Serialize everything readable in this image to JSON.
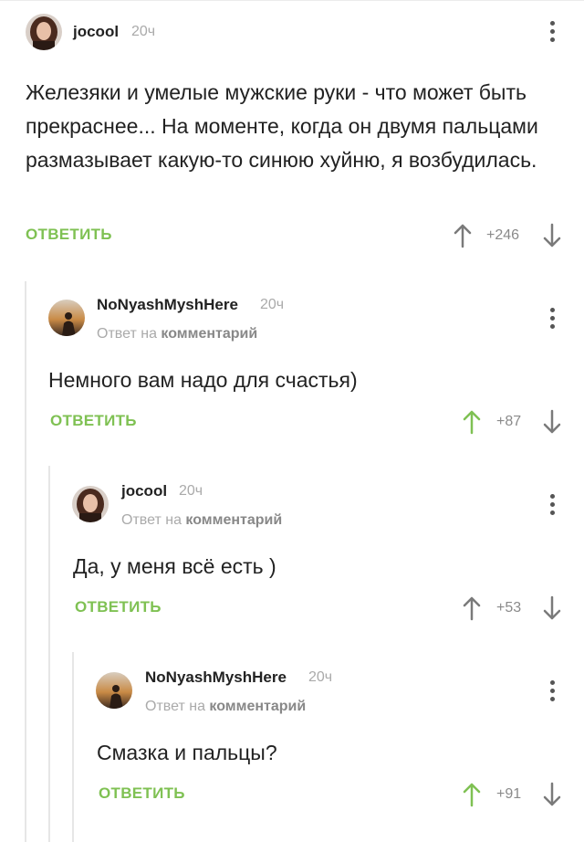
{
  "comments": [
    {
      "author": "jocool",
      "time": "20ч",
      "text": "Железяки и умелые мужские руки - что может быть прекраснее... На моменте, когда он двумя пальцами размазывает какую-то синюю хуйню, я возбудилась.",
      "reply_label": "ОТВЕТИТЬ",
      "score": "+246",
      "upvoted": false
    },
    {
      "author": "NoNyashMyshHere",
      "time": "20ч",
      "reply_prefix": "Ответ на",
      "reply_target": "комментарий",
      "text": "Немного вам надо для счастья)",
      "reply_label": "ОТВЕТИТЬ",
      "score": "+87",
      "upvoted": true
    },
    {
      "author": "jocool",
      "time": "20ч",
      "reply_prefix": "Ответ на",
      "reply_target": "комментарий",
      "text": "Да, у меня всё есть )",
      "reply_label": "ОТВЕТИТЬ",
      "score": "+53",
      "upvoted": false
    },
    {
      "author": "NoNyashMyshHere",
      "time": "20ч",
      "reply_prefix": "Ответ на",
      "reply_target": "комментарий",
      "text": "Смазка и пальцы?",
      "reply_label": "ОТВЕТИТЬ",
      "score": "+91",
      "upvoted": true
    }
  ],
  "colors": {
    "accent_green": "#7fc153",
    "muted_text": "#aaaaaa",
    "arrow_default": "#7a7a7a"
  }
}
